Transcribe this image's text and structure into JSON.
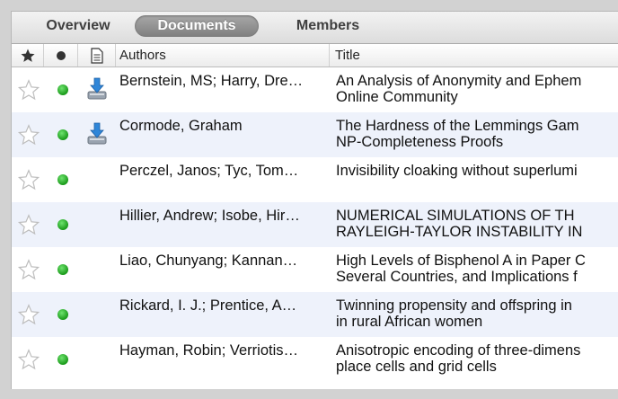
{
  "tabs": {
    "overview": "Overview",
    "documents": "Documents",
    "members": "Members"
  },
  "columns": {
    "star_icon": "star-icon",
    "read_icon": "dot-icon",
    "doc_icon": "document-icon",
    "authors": "Authors",
    "title": "Title"
  },
  "rows": [
    {
      "authors": "Bernstein, MS; Harry, Dre…",
      "title1": "An Analysis of Anonymity and Ephem",
      "title2": "Online Community",
      "has_file": true
    },
    {
      "authors": "Cormode, Graham",
      "title1": "The Hardness of the Lemmings Gam",
      "title2": "NP-Completeness Proofs",
      "has_file": true
    },
    {
      "authors": "Perczel, Janos; Tyc, Tom…",
      "title1": "Invisibility cloaking without superlumi",
      "title2": "",
      "has_file": false
    },
    {
      "authors": "Hillier, Andrew; Isobe, Hir…",
      "title1": "NUMERICAL SIMULATIONS OF TH",
      "title2": "RAYLEIGH-TAYLOR INSTABILITY IN",
      "has_file": false
    },
    {
      "authors": "Liao, Chunyang; Kannan…",
      "title1": "High Levels of Bisphenol A in Paper C",
      "title2": "Several Countries, and Implications f",
      "has_file": false
    },
    {
      "authors": "Rickard, I. J.; Prentice, A…",
      "title1": "Twinning propensity and offspring in",
      "title2": "in rural African women",
      "has_file": false
    },
    {
      "authors": "Hayman, Robin; Verriotis…",
      "title1": "Anisotropic encoding of three-dimens",
      "title2": "place cells and grid cells",
      "has_file": false
    }
  ],
  "colors": {
    "alt_row": "#eef2fb",
    "read_dot": "#1a9a1a",
    "active_tab": "#8f8f8f"
  }
}
